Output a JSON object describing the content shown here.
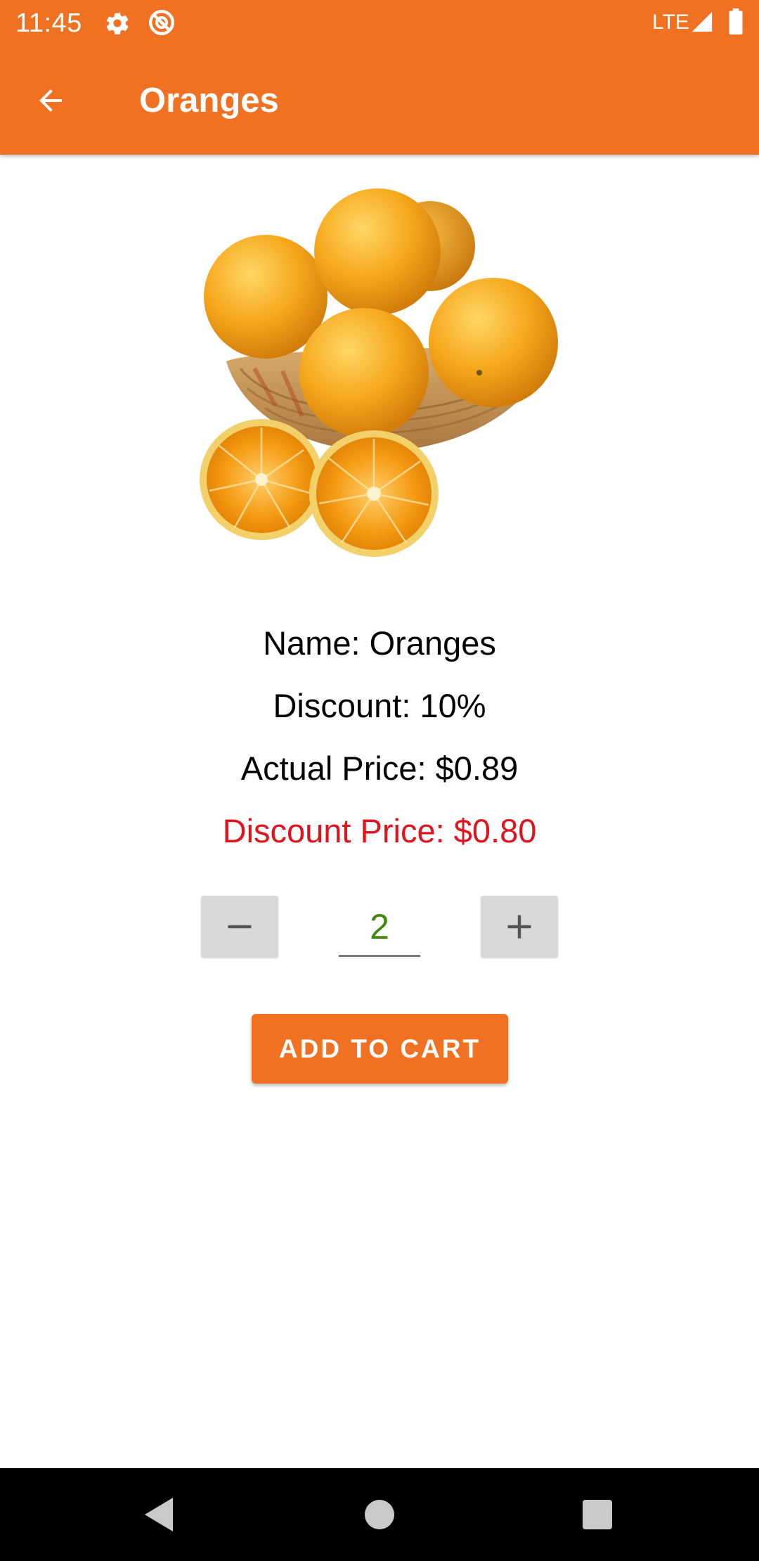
{
  "status_bar": {
    "time": "11:45",
    "network": "LTE",
    "icons": [
      "gear-icon",
      "sync-icon",
      "signal-icon",
      "battery-icon"
    ]
  },
  "app_bar": {
    "title": "Oranges",
    "back_icon": "arrow-left-icon"
  },
  "product": {
    "image_icon": "oranges-basket-image",
    "name_line": "Name: Oranges",
    "discount_line": "Discount: 10%",
    "actual_price_line": "Actual Price: $0.89",
    "discount_price_line": "Discount Price: $0.80"
  },
  "quantity": {
    "value": "2",
    "decrement_icon": "minus-icon",
    "increment_icon": "plus-icon"
  },
  "actions": {
    "add_to_cart_label": "ADD TO CART"
  },
  "nav_bar": {
    "icons": [
      "nav-back-icon",
      "nav-home-icon",
      "nav-recents-icon"
    ]
  },
  "colors": {
    "accent": "#f07122",
    "discount_price": "#e0141c",
    "quantity_text": "#3f8a0a",
    "stepper_button": "#d9d9d9",
    "nav_bar": "#000000"
  }
}
